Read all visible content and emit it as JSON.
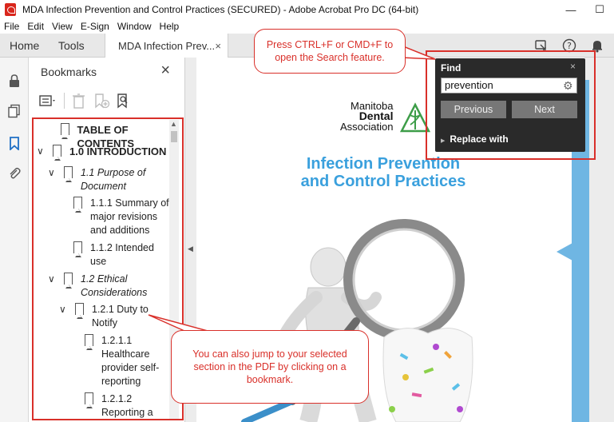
{
  "window": {
    "title": "MDA Infection Prevention and Control Practices (SECURED) - Adobe Acrobat Pro DC (64-bit)",
    "minimize": "—",
    "maximize": "☐",
    "app_icon": "acrobat-icon"
  },
  "menu": [
    "File",
    "Edit",
    "View",
    "E-Sign",
    "Window",
    "Help"
  ],
  "tabs": {
    "home": "Home",
    "tools": "Tools",
    "document": "MDA Infection Prev...",
    "close": "×"
  },
  "toolbar_icons": [
    "share-screen-icon",
    "help-icon",
    "bell-icon"
  ],
  "rail_icons": [
    "lock-icon",
    "pages-icon",
    "bookmark-icon",
    "attachment-icon"
  ],
  "bookmarks": {
    "header": "Bookmarks",
    "close": "×",
    "tool_icons": [
      "options-menu-icon",
      "delete-icon",
      "new-bookmark-icon",
      "bookmark-search-icon"
    ],
    "items": [
      {
        "label": "TABLE OF CONTENTS",
        "style": "bold",
        "chevron": ""
      },
      {
        "label": "1.0 INTRODUCTION",
        "style": "bold",
        "chevron": "∨"
      },
      {
        "label": "1.1 Purpose of Document",
        "style": "italic",
        "chevron": "∨"
      },
      {
        "label": "1.1.1 Summary of major revisions and additions",
        "style": "normal",
        "chevron": ""
      },
      {
        "label": "1.1.2 Intended use",
        "style": "normal",
        "chevron": ""
      },
      {
        "label": "1.2 Ethical Considerations",
        "style": "italic",
        "chevron": "∨"
      },
      {
        "label": "1.2.1 Duty to Notify",
        "style": "normal",
        "chevron": "∨"
      },
      {
        "label": "1.2.1.1 Healthcare provider self-reporting",
        "style": "normal",
        "chevron": ""
      },
      {
        "label": "1.2.1.2 Reporting a",
        "style": "normal",
        "chevron": ""
      }
    ]
  },
  "document": {
    "logo_lines": [
      "Manitoba",
      "Dental",
      "Association"
    ],
    "title_line1": "Infection Prevention",
    "title_line2": "and Control Practices"
  },
  "find": {
    "title": "Find",
    "close": "×",
    "query": "prevention",
    "previous": "Previous",
    "next": "Next",
    "replace": "Replace with"
  },
  "callouts": {
    "find": "Press CTRL+F or CMD+F to open the Search feature.",
    "bookmark": "You can also jump to your selected section in the PDF by clicking on a bookmark."
  },
  "colors": {
    "annotation_red": "#d9302a",
    "title_blue": "#3aa0dd",
    "strip_blue": "#6fb6e3"
  }
}
